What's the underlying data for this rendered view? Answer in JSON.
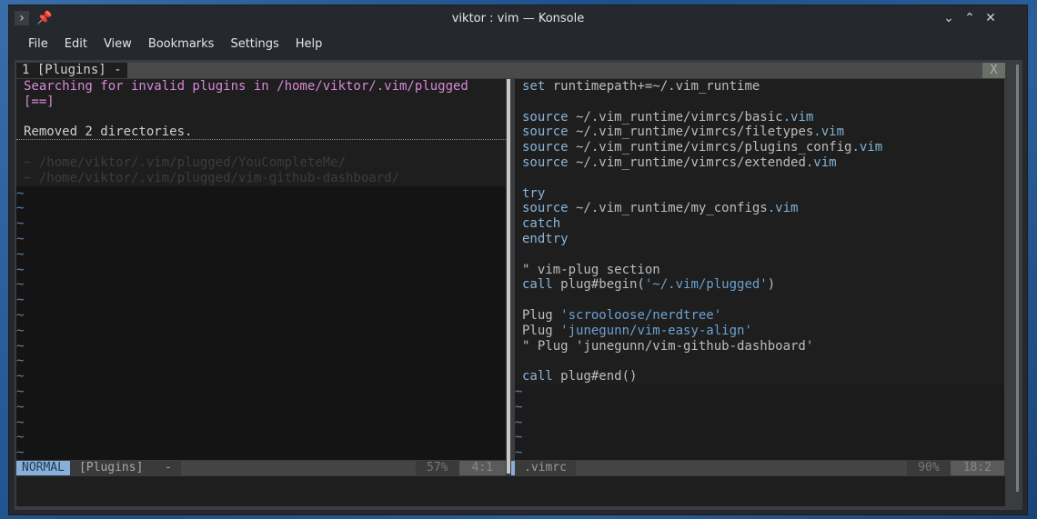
{
  "window": {
    "title": "viktor : vim — Konsole",
    "menu": [
      "File",
      "Edit",
      "View",
      "Bookmarks",
      "Settings",
      "Help"
    ]
  },
  "tabline": {
    "tab": "1 [Plugins] -",
    "close": "X"
  },
  "left": {
    "lines": [
      {
        "t": "Searching for invalid plugins in /home/viktor/.vim/plugged",
        "c": "pink"
      },
      {
        "t": "[==]",
        "c": "pink"
      },
      {
        "t": "",
        "c": ""
      },
      {
        "t": "Removed 2 directories.",
        "c": "wt"
      },
      {
        "t": "",
        "c": ""
      },
      {
        "t": "~ /home/viktor/.vim/plugged/YouCompleteMe/",
        "c": "gray"
      },
      {
        "t": "~ /home/viktor/.vim/plugged/vim-github-dashboard/",
        "c": "gray"
      }
    ],
    "tilde_count": 18
  },
  "right": {
    "lines": [
      [
        [
          "set",
          "kw"
        ],
        [
          " runtimepath+=~/.vim_runtime",
          "cm"
        ]
      ],
      [],
      [
        [
          "source",
          "kw"
        ],
        [
          " ~/.vim_runtime/vimrcs/basic",
          "cm"
        ],
        [
          ".vim",
          "bl"
        ]
      ],
      [
        [
          "source",
          "kw"
        ],
        [
          " ~/.vim_runtime/vimrcs/filetypes",
          "cm"
        ],
        [
          ".vim",
          "bl"
        ]
      ],
      [
        [
          "source",
          "kw"
        ],
        [
          " ~/.vim_runtime/vimrcs/plugins_config",
          "cm"
        ],
        [
          ".vim",
          "bl"
        ]
      ],
      [
        [
          "source",
          "kw"
        ],
        [
          " ~/.vim_runtime/vimrcs/extended",
          "cm"
        ],
        [
          ".vim",
          "bl"
        ]
      ],
      [],
      [
        [
          "try",
          "kw"
        ]
      ],
      [
        [
          "source",
          "kw"
        ],
        [
          " ~/.vim_runtime/my_configs",
          "cm"
        ],
        [
          ".vim",
          "bl"
        ]
      ],
      [
        [
          "catch",
          "kw"
        ]
      ],
      [
        [
          "endtry",
          "kw"
        ]
      ],
      [],
      [
        [
          "\" vim-plug section",
          "cm"
        ]
      ],
      [
        [
          "call",
          "kw"
        ],
        [
          " plug#begin(",
          "cm"
        ],
        [
          "'~/.vim/plugged'",
          "st"
        ],
        [
          ")",
          "cm"
        ]
      ],
      [],
      [
        [
          "Plug ",
          "cm"
        ],
        [
          "'scrooloose/nerdtree'",
          "st"
        ]
      ],
      [
        [
          "Plug ",
          "cm"
        ],
        [
          "'junegunn/vim-easy-align'",
          "st"
        ]
      ],
      [
        [
          "\" Plug 'junegunn/vim-github-dashboard'",
          "cm"
        ]
      ],
      [],
      [
        [
          "call",
          "kw"
        ],
        [
          " plug#end()",
          "cm"
        ]
      ]
    ],
    "tilde_count": 5
  },
  "status_left": {
    "mode": "NORMAL",
    "file": "[Plugins]",
    "flag": "-",
    "percent": "57%",
    "position": "4:1"
  },
  "status_right": {
    "file": ".vimrc",
    "percent": "90%",
    "position": "18:2"
  }
}
